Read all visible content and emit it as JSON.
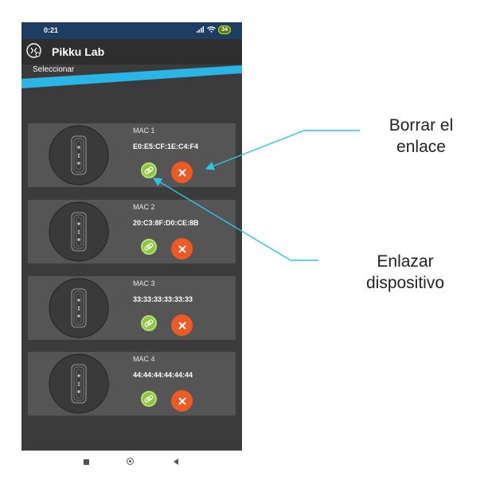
{
  "status_bar": {
    "time": "0:21",
    "battery": "34"
  },
  "app_bar": {
    "title": "Pikku Lab"
  },
  "sub_bar": {
    "title": "Seleccionar"
  },
  "devices": [
    {
      "label": "MAC 1",
      "address": "E0:E5:CF:1E:C4:F4"
    },
    {
      "label": "MAC 2",
      "address": "20:C3:8F:D0:CE:8B"
    },
    {
      "label": "MAC 3",
      "address": "33:33:33:33:33:33"
    },
    {
      "label": "MAC 4",
      "address": "44:44:44:44:44:44"
    }
  ],
  "annotations": {
    "delete_link": [
      "Borrar el",
      "enlace"
    ],
    "link_device": [
      "Enlazar",
      "dispositivo"
    ]
  },
  "colors": {
    "status_bar": "#1d3d62",
    "accent_ribbon": "#29b6e6",
    "link_button": "#8cc63f",
    "delete_button": "#ee5a24",
    "annotation_line": "#29c6e6"
  }
}
